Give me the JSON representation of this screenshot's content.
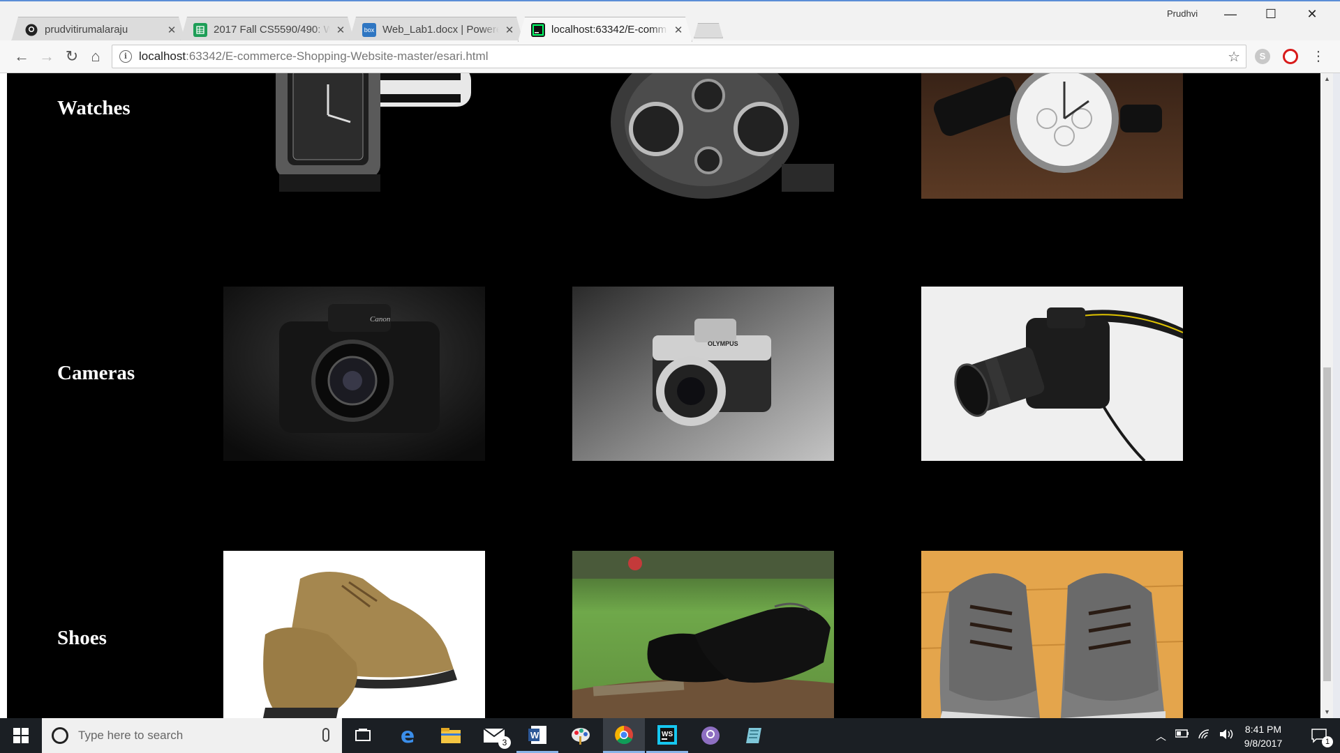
{
  "browser": {
    "user": "Prudhvi",
    "tabs": [
      {
        "title": "prudvitirumalaraju",
        "icon": "github-icon"
      },
      {
        "title": "2017 Fall CS5590/490: W",
        "icon": "sheets-icon"
      },
      {
        "title": "Web_Lab1.docx | Powere",
        "icon": "box-icon"
      },
      {
        "title": "localhost:63342/E-comm",
        "icon": "webstorm-icon"
      }
    ],
    "url_host": "localhost",
    "url_path": ":63342/E-commerce-Shopping-Website-master/esari.html"
  },
  "page": {
    "categories": [
      {
        "label": "Watches",
        "items": [
          "Black square-dial watch",
          "Multi-dial steampunk watch",
          "Silver chronograph watch"
        ]
      },
      {
        "label": "Cameras",
        "items": [
          "Canon EOS camera",
          "Olympus mirrorless camera",
          "Nikon DSLR camera"
        ]
      },
      {
        "label": "Shoes",
        "items": [
          "Tan suede shoes",
          "Black leather dress shoes",
          "Grey canvas sneakers"
        ]
      }
    ]
  },
  "taskbar": {
    "search_placeholder": "Type here to search",
    "mail_badge": "3",
    "time": "8:41 PM",
    "date": "9/8/2017",
    "notification_count": "1"
  },
  "colors": {
    "page_bg": "#000000",
    "label_color": "#ffffff",
    "taskbar_bg": "#1b1f24",
    "accent": "#5b8dd6"
  }
}
